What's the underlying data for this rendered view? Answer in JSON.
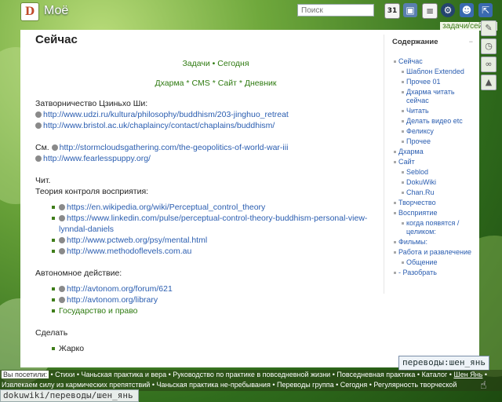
{
  "site": {
    "logo_text": "D",
    "title": "Моё"
  },
  "search": {
    "placeholder": "Поиск"
  },
  "calendar": {
    "day": "31"
  },
  "breadcrumb": {
    "parent": "задачи",
    "current": "/сейчас"
  },
  "page": {
    "title": "Сейчас",
    "nav1": [
      "Задачи",
      "Сегодня"
    ],
    "nav1_sep": "•",
    "nav2": [
      "Дхарма",
      "CMS",
      "Сайт",
      "Дневник"
    ],
    "nav2_sep": "*",
    "section1_title": "Затворничество Цзиньхо Ши:",
    "section1_links": [
      "http://www.udzi.ru/kultura/philosophy/buddhism/203-jinghuo_retreat",
      "http://www.bristol.ac.uk/chaplaincy/contact/chaplains/buddhism/"
    ],
    "see_prefix": "См.",
    "see_links": [
      "http://stormcloudsgathering.com/the-geopolitics-of-world-war-iii",
      "http://www.fearlesspuppy.org/"
    ],
    "read_label": "Чит.",
    "theory_label": "Теория контроля восприятия:",
    "theory_links": [
      "https://en.wikipedia.org/wiki/Perceptual_control_theory",
      "https://www.linkedin.com/pulse/perceptual-control-theory-buddhism-personal-view-lynndal-daniels",
      "http://www.pctweb.org/psy/mental.html",
      "http://www.methodoflevels.com.au"
    ],
    "auto_label": "Автономное действие:",
    "auto_links": [
      "http://avtonom.org/forum/621",
      "http://avtonom.org/library"
    ],
    "auto_internal": "Государство и право",
    "todo_label": "Сделать",
    "todo_items": [
      "Жарко"
    ]
  },
  "toc": {
    "title": "Содержание",
    "toggle": "−",
    "items": [
      {
        "label": "Сейчас",
        "children": [
          "Шаблон Extended",
          "Прочее 01",
          "Дхарма читать сейчас",
          "Читать",
          "Делать видео etc",
          "Феликсу",
          "Прочее"
        ]
      },
      {
        "label": "Дхарма",
        "children": []
      },
      {
        "label": "Сайт",
        "children": [
          "Seblod",
          "DokuWiki",
          "Chan.Ru"
        ]
      },
      {
        "label": "Творчество",
        "children": []
      },
      {
        "label": "Восприятие",
        "children": [
          "когда появятся /целиком:"
        ]
      },
      {
        "label": "Фильмы:",
        "children": []
      },
      {
        "label": "Работа и развлечение",
        "children": [
          "Общение"
        ]
      },
      {
        "label": "- Разобрать",
        "children": []
      }
    ]
  },
  "tooltip": "переводы:шен_янь",
  "visited": {
    "label": "Вы посетили:",
    "line1": [
      "Стихи",
      "Чаньская практика и вера",
      "Руководство по практике в повседневной жизни",
      "Повседневная практика",
      "Каталог",
      "Шен Янь"
    ],
    "line2": [
      "Извлекаем силу из кармических препятствий",
      "Чаньская практика не-пребывания",
      "Переводы группа",
      "Сегодня",
      "Регулярность творческой"
    ]
  },
  "statusbar": "dokuwiki/переводы/шен_янь",
  "colors": {
    "link": "#2a5db0",
    "internal_link": "#2e7a10",
    "accent": "#3b7a16"
  }
}
